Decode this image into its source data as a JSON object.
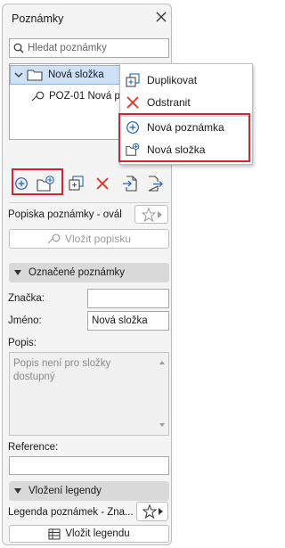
{
  "panel": {
    "title": "Poznámky",
    "search": {
      "placeholder": "Hledat poznámky",
      "value": ""
    },
    "tree": {
      "folder_label": "Nová složka",
      "note_label": "POZ-01 Nová p"
    },
    "label_section": {
      "label_title": "Popiska poznámky - ovál",
      "insert_label_button": "Vložit popisku"
    },
    "marked_section": {
      "header": "Označené poznámky",
      "mark_label": "Značka:",
      "mark_value": "",
      "name_label": "Jméno:",
      "name_value": "Nová složka",
      "description_label": "Popis:",
      "description_text": "Popis není pro složky dostupný",
      "reference_label": "Reference:",
      "reference_value": ""
    },
    "legend_section": {
      "header": "Vložení legendy",
      "legend_label": "Legenda poznámek - Zna...",
      "insert_legend_button": "Vložit legendu"
    }
  },
  "context_menu": {
    "items": [
      {
        "label": "Duplikovat",
        "icon": "duplicate-icon"
      },
      {
        "label": "Odstranit",
        "icon": "delete-icon"
      },
      {
        "label": "Nová poznámka",
        "icon": "add-note-icon"
      },
      {
        "label": "Nová složka",
        "icon": "new-folder-icon"
      }
    ]
  },
  "colors": {
    "highlight": "#d8232a",
    "accent_blue": "#1f5fbf",
    "delete_red": "#e0301e",
    "selection": "#cfe1f7"
  }
}
